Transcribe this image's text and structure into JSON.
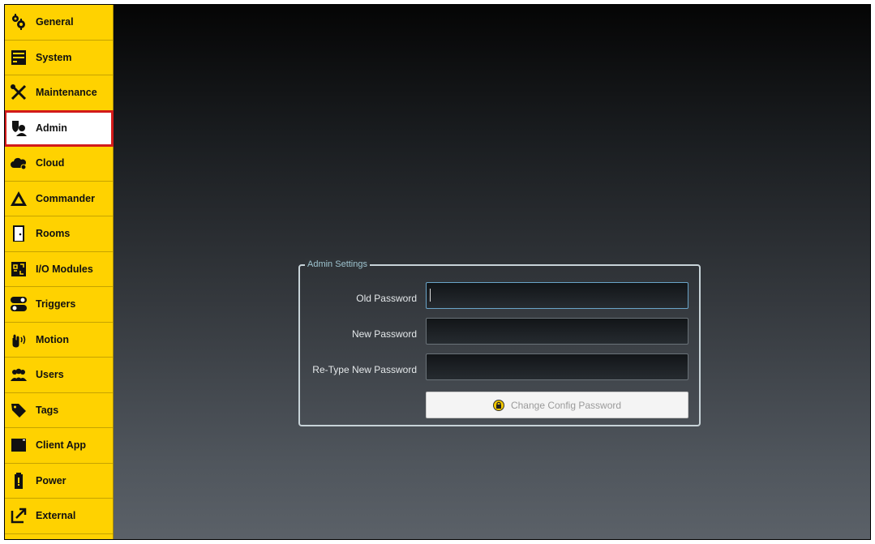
{
  "sidebar": {
    "items": [
      {
        "label": "General",
        "icon": "gears-icon"
      },
      {
        "label": "System",
        "icon": "server-icon"
      },
      {
        "label": "Maintenance",
        "icon": "tools-icon"
      },
      {
        "label": "Admin",
        "icon": "admin-shield-icon",
        "selected": true
      },
      {
        "label": "Cloud",
        "icon": "cloud-icon"
      },
      {
        "label": "Commander",
        "icon": "commander-icon"
      },
      {
        "label": "Rooms",
        "icon": "door-icon"
      },
      {
        "label": "I/O Modules",
        "icon": "circuit-icon"
      },
      {
        "label": "Triggers",
        "icon": "toggle-icon"
      },
      {
        "label": "Motion",
        "icon": "motion-hand-icon"
      },
      {
        "label": "Users",
        "icon": "users-icon"
      },
      {
        "label": "Tags",
        "icon": "tag-icon"
      },
      {
        "label": "Client App",
        "icon": "window-icon"
      },
      {
        "label": "Power",
        "icon": "battery-icon"
      },
      {
        "label": "External",
        "icon": "external-link-icon"
      }
    ]
  },
  "admin_settings": {
    "legend": "Admin Settings",
    "old_password_label": "Old Password",
    "new_password_label": "New Password",
    "retype_password_label": "Re-Type New Password",
    "old_password_value": "",
    "new_password_value": "",
    "retype_password_value": "",
    "change_button_label": "Change Config Password",
    "change_button_icon": "lock-icon"
  },
  "colors": {
    "sidebar_bg": "#ffd200",
    "selection_outline": "#d21a1a",
    "panel_border": "#c7d3d8",
    "legend_text": "#9ec4cf"
  }
}
